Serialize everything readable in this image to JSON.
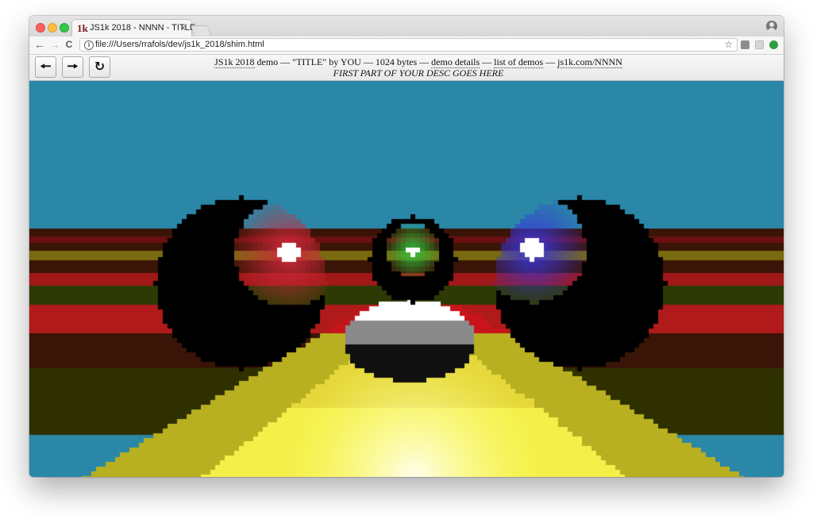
{
  "browser": {
    "tab": {
      "favicon": "1k",
      "title": "JS1k 2018 - NNNN - TITLE",
      "close": "×"
    },
    "url": "file:///Users/rrafols/dev/js1k_2018/shim.html",
    "icons": {
      "back": "←",
      "forward": "→",
      "reload": "C",
      "info": "i",
      "star": "☆"
    }
  },
  "shim": {
    "buttons": {
      "prev": "🠔",
      "next": "🠖",
      "reload": "↻"
    },
    "line1": {
      "prefix_link": "JS1k 2018",
      "prefix_rest": " demo — \"TITLE\" by YOU — 1024 bytes — ",
      "details_link": "demo details",
      "sep1": " — ",
      "list_link": "list of demos",
      "sep2": " — ",
      "site_link": "js1k.com/NNNN"
    },
    "desc": "FIRST PART OF YOUR DESC GOES HERE"
  },
  "scene": {
    "sky_color": "#2a87a8",
    "floor_dark": "#3a1200",
    "floor_red": "#c8141a",
    "floor_yellow": "#d8c01c",
    "sphere_left_color": "#d02a3a",
    "sphere_center_color": "#2ec23a",
    "sphere_right_color": "#3a36d8"
  }
}
